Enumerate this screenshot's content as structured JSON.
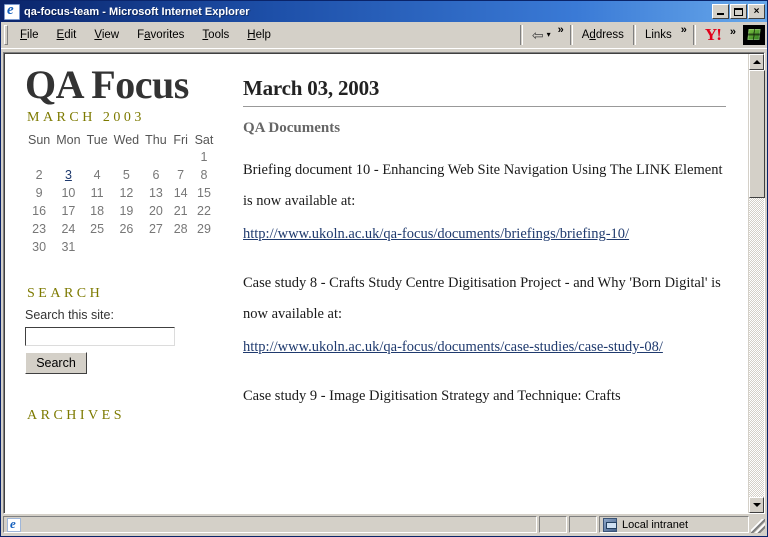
{
  "window": {
    "title": "qa-focus-team - Microsoft Internet Explorer",
    "app_icon": "internet-explorer-icon",
    "minimize_label": "",
    "maximize_label": "",
    "close_label": "×"
  },
  "menu": {
    "items": [
      {
        "label": "File",
        "accesskey": "F"
      },
      {
        "label": "Edit",
        "accesskey": "E"
      },
      {
        "label": "View",
        "accesskey": "V"
      },
      {
        "label": "Favorites",
        "accesskey": "a"
      },
      {
        "label": "Tools",
        "accesskey": "T"
      },
      {
        "label": "Help",
        "accesskey": "H"
      }
    ]
  },
  "toolbar": {
    "back_icon": "back-arrow-icon",
    "back_caret": "▾",
    "overflow_chevron": "»",
    "address_label": "Address",
    "address_accesskey": "d",
    "links_label": "Links",
    "links_chevron": "»",
    "yahoo_logo_text": "Y!",
    "yahoo_chevron": "»",
    "windows_tile_icon": "windows-logo-icon"
  },
  "page": {
    "site_title": "QA Focus",
    "calendar": {
      "heading": "MARCH 2003",
      "weekdays": [
        "Sun",
        "Mon",
        "Tue",
        "Wed",
        "Thu",
        "Fri",
        "Sat"
      ],
      "weeks": [
        [
          "",
          "",
          "",
          "",
          "",
          "",
          "1"
        ],
        [
          "2",
          "3",
          "4",
          "5",
          "6",
          "7",
          "8"
        ],
        [
          "9",
          "10",
          "11",
          "12",
          "13",
          "14",
          "15"
        ],
        [
          "16",
          "17",
          "18",
          "19",
          "20",
          "21",
          "22"
        ],
        [
          "23",
          "24",
          "25",
          "26",
          "27",
          "28",
          "29"
        ],
        [
          "30",
          "31",
          "",
          "",
          "",
          "",
          ""
        ]
      ],
      "linked_days": [
        "3"
      ]
    },
    "search": {
      "heading": "SEARCH",
      "label": "Search this site:",
      "value": "",
      "placeholder": "",
      "button_label": "Search"
    },
    "archives": {
      "heading": "ARCHIVES"
    },
    "entry": {
      "date": "March 03, 2003",
      "title": "QA Documents",
      "paragraphs": [
        "Briefing document 10 - Enhancing Web Site Navigation Using The LINK Element is now available at:",
        "Case study 8 - Crafts Study Centre Digitisation Project - and Why 'Born Digital' is now available at:",
        "Case study 9 - Image Digitisation Strategy and Technique: Crafts"
      ],
      "links": [
        "http://www.ukoln.ac.uk/qa-focus/documents/briefings/briefing-10/",
        "http://www.ukoln.ac.uk/qa-focus/documents/case-studies/case-study-08/"
      ]
    }
  },
  "scrollbar": {
    "up_arrow": "scroll-up-arrow-icon",
    "down_arrow": "scroll-down-arrow-icon",
    "thumb_position_percent": 0,
    "thumb_size_percent": 30
  },
  "statusbar": {
    "message": "",
    "zone_label": "Local intranet",
    "zone_icon": "local-intranet-icon",
    "page_icon": "internet-explorer-icon"
  },
  "colors": {
    "titlebar_blue": "#0a246a",
    "chrome_gray": "#d4d0c8",
    "heading_olive": "#7d7a00",
    "link_navy": "#1f3a6e",
    "entry_title_gray": "#666666",
    "yahoo_red": "#e2001a"
  }
}
